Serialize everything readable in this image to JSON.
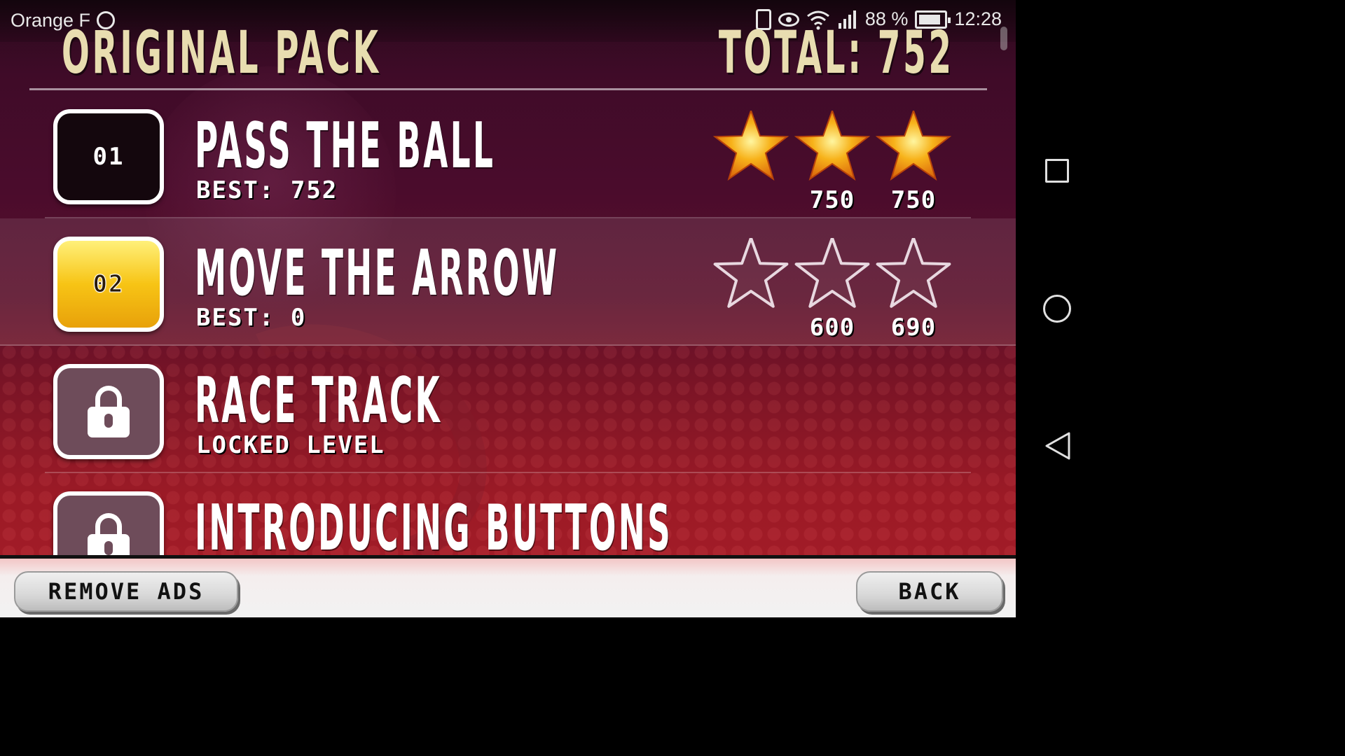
{
  "status_bar": {
    "carrier": "Orange F",
    "battery_percent": "88 %",
    "time": "12:28",
    "icons": [
      "whatsapp-icon",
      "vibrate-icon",
      "eye-icon",
      "wifi-icon",
      "signal-icon",
      "battery-charging-icon"
    ]
  },
  "header": {
    "pack_title": "ORIGINAL PACK",
    "total_label": "TOTAL:",
    "total_value": "752"
  },
  "levels": [
    {
      "number": "01",
      "name": "PASS THE BALL",
      "best_label": "BEST:",
      "best_value": "752",
      "state": "completed",
      "stars_earned": 3,
      "star_thresholds": [
        "750",
        "750"
      ]
    },
    {
      "number": "02",
      "name": "MOVE THE ARROW",
      "best_label": "BEST:",
      "best_value": "0",
      "state": "current",
      "stars_earned": 0,
      "star_thresholds": [
        "600",
        "690"
      ]
    },
    {
      "number": "",
      "name": "RACE TRACK",
      "subtitle": "LOCKED LEVEL",
      "state": "locked"
    },
    {
      "number": "",
      "name": "INTRODUCING BUTTONS",
      "state": "locked"
    }
  ],
  "footer": {
    "remove_ads_label": "REMOVE ADS",
    "back_label": "BACK"
  },
  "colors": {
    "title_gold": "#e8ddb0",
    "star_gold": "#f7b21a",
    "badge_current": "#f7c415"
  }
}
